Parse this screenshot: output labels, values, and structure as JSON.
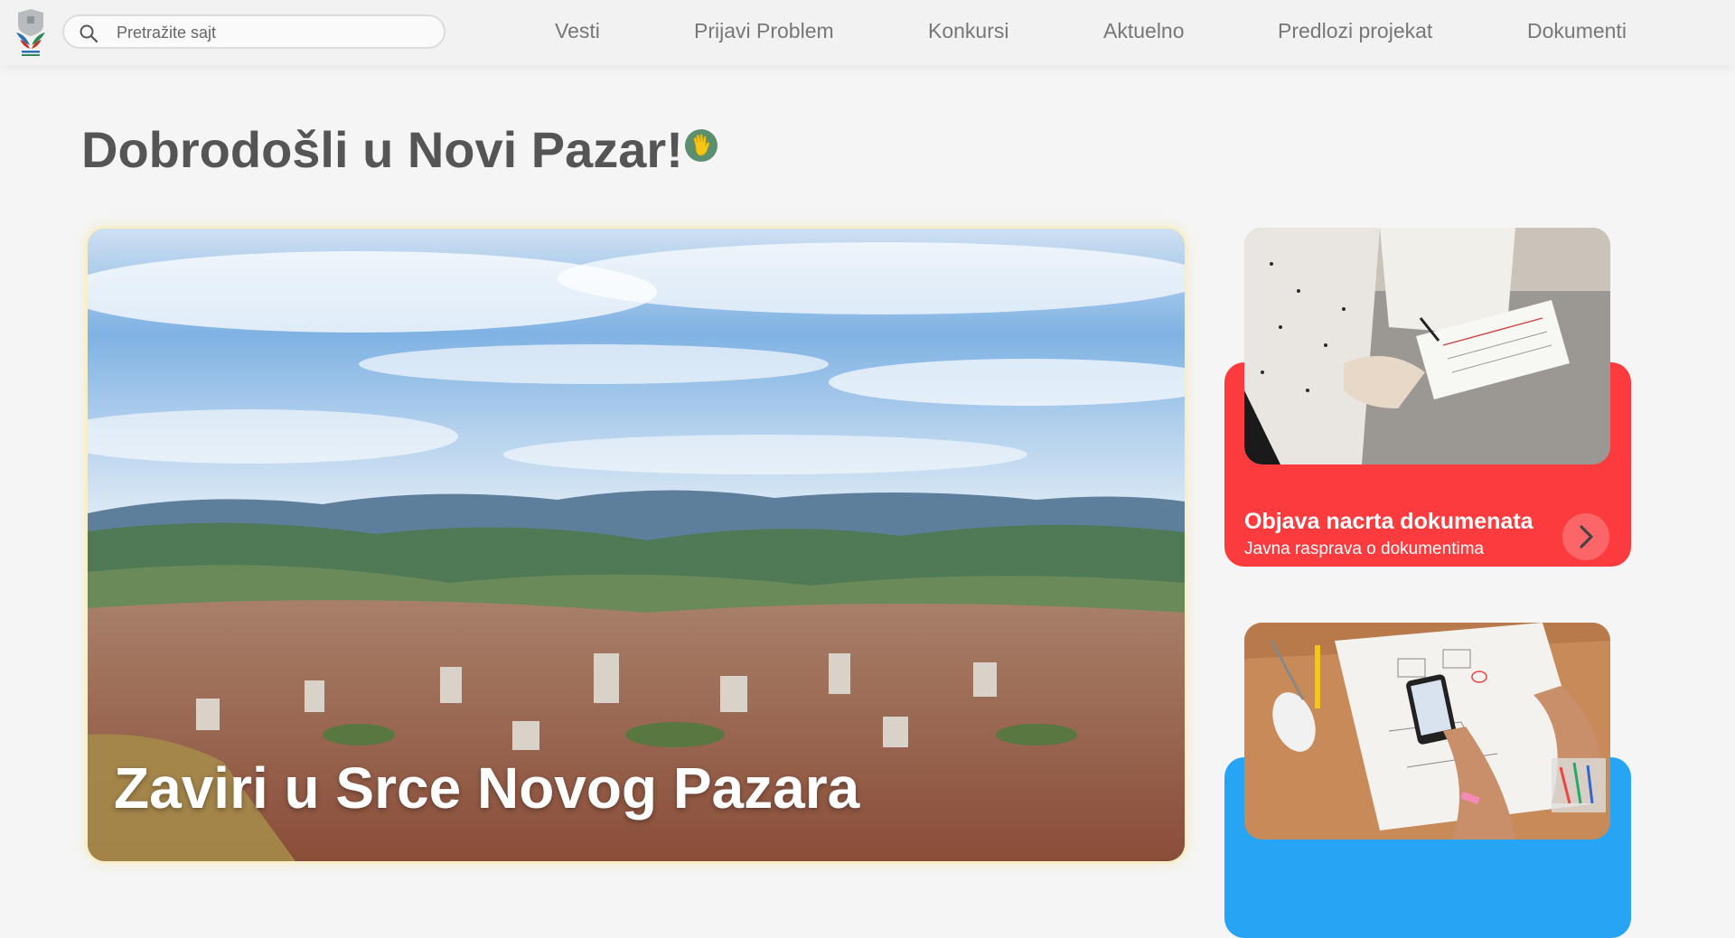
{
  "header": {
    "search_placeholder": "Pretražite sajt",
    "nav": [
      "Vesti",
      "Prijavi Problem",
      "Konkursi",
      "Aktuelno",
      "Predlozi projekat",
      "Dokumenti"
    ]
  },
  "main": {
    "welcome_title": "Dobrodošli u Novi Pazar!",
    "welcome_emoji": "waving-hand-icon",
    "hero": {
      "title": "Zaviri u Srce Novog Pazara",
      "image": "city-panorama"
    },
    "cards": [
      {
        "title": "Objava nacrta dokumenata",
        "subtitle": "Javna rasprava o dokumentima",
        "color": "#fc3b3e",
        "image": "documents-signing",
        "icon": "chevron-right-icon"
      },
      {
        "title": "",
        "subtitle": "",
        "color": "#28a4f5",
        "image": "desk-planning",
        "icon": "chevron-right-icon"
      }
    ]
  },
  "colors": {
    "background": "#f5f5f5",
    "heading": "#555555",
    "nav_text": "#777777",
    "card_red": "#fc3b3e",
    "card_blue": "#28a4f5"
  }
}
